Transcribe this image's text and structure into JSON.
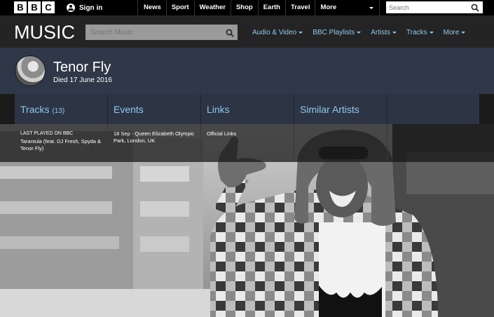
{
  "bbc": {
    "logo_letters": [
      "B",
      "B",
      "C"
    ],
    "signin_label": "Sign in",
    "nav": [
      "News",
      "Sport",
      "Weather",
      "Shop",
      "Earth",
      "Travel",
      "More"
    ],
    "search_placeholder": "Search"
  },
  "music": {
    "logo": "MUSIC",
    "search_placeholder": "Search Music",
    "nav": [
      "Audio & Video",
      "BBC Playlists",
      "Artists",
      "Tracks",
      "More"
    ]
  },
  "artist": {
    "name": "Tenor Fly",
    "died": "Died 17 June 2016"
  },
  "tabs": {
    "tracks": "Tracks",
    "tracks_count": "(13)",
    "events": "Events",
    "links": "Links",
    "similar": "Similar Artists"
  },
  "panels": {
    "last_played_title": "LAST PLAYED ON BBC",
    "last_played_track": "Tarantula (feat. DJ Fresh, Spyda & Tenor Fly)",
    "event": "18 Sep - Queen Elizabeth Olympic Park, London, UK",
    "links": "Official Links"
  },
  "colors": {
    "accent_link": "#8fc7ec",
    "artist_bar": "#2f3848",
    "tab_bar": "#2d3545"
  }
}
